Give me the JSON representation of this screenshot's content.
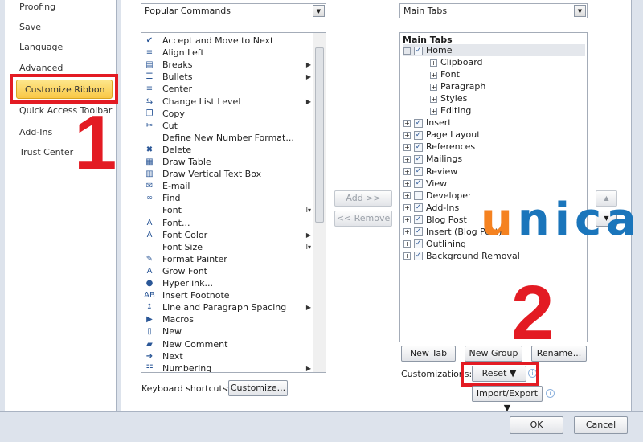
{
  "sidebar": {
    "items": [
      "Proofing",
      "Save",
      "Language",
      "Advanced",
      "Customize Ribbon",
      "Quick Access Toolbar",
      "Add-Ins",
      "Trust Center"
    ],
    "selected": "Customize Ribbon"
  },
  "annotations": {
    "step1": "1",
    "step2": "2",
    "highlight_color": "#e31b23"
  },
  "commands": {
    "dropdown": "Popular Commands",
    "items": [
      {
        "label": "Accept and Move to Next",
        "icon": "accept-icon",
        "sub": ""
      },
      {
        "label": "Align Left",
        "icon": "align-left-icon",
        "sub": ""
      },
      {
        "label": "Breaks",
        "icon": "breaks-icon",
        "sub": "▶"
      },
      {
        "label": "Bullets",
        "icon": "bullets-icon",
        "sub": "▶"
      },
      {
        "label": "Center",
        "icon": "center-icon",
        "sub": ""
      },
      {
        "label": "Change List Level",
        "icon": "list-level-icon",
        "sub": "▶"
      },
      {
        "label": "Copy",
        "icon": "copy-icon",
        "sub": ""
      },
      {
        "label": "Cut",
        "icon": "scissors-icon",
        "sub": ""
      },
      {
        "label": "Define New Number Format...",
        "icon": "",
        "sub": ""
      },
      {
        "label": "Delete",
        "icon": "delete-icon",
        "sub": ""
      },
      {
        "label": "Draw Table",
        "icon": "draw-table-icon",
        "sub": ""
      },
      {
        "label": "Draw Vertical Text Box",
        "icon": "text-box-icon",
        "sub": ""
      },
      {
        "label": "E-mail",
        "icon": "email-icon",
        "sub": ""
      },
      {
        "label": "Find",
        "icon": "binoculars-icon",
        "sub": ""
      },
      {
        "label": "Font",
        "icon": "",
        "sub": "I▾"
      },
      {
        "label": "Font...",
        "icon": "font-icon",
        "sub": ""
      },
      {
        "label": "Font Color",
        "icon": "font-color-icon",
        "sub": "▶"
      },
      {
        "label": "Font Size",
        "icon": "",
        "sub": "I▾"
      },
      {
        "label": "Format Painter",
        "icon": "brush-icon",
        "sub": ""
      },
      {
        "label": "Grow Font",
        "icon": "grow-font-icon",
        "sub": ""
      },
      {
        "label": "Hyperlink...",
        "icon": "globe-icon",
        "sub": ""
      },
      {
        "label": "Insert Footnote",
        "icon": "footnote-icon",
        "sub": ""
      },
      {
        "label": "Line and Paragraph Spacing",
        "icon": "spacing-icon",
        "sub": "▶"
      },
      {
        "label": "Macros",
        "icon": "play-icon",
        "sub": ""
      },
      {
        "label": "New",
        "icon": "new-doc-icon",
        "sub": ""
      },
      {
        "label": "New Comment",
        "icon": "comment-icon",
        "sub": ""
      },
      {
        "label": "Next",
        "icon": "next-icon",
        "sub": ""
      },
      {
        "label": "Numbering",
        "icon": "numbering-icon",
        "sub": "▶"
      }
    ]
  },
  "glyphs": {
    "accept-icon": "✔",
    "align-left-icon": "≡",
    "breaks-icon": "▤",
    "bullets-icon": "☰",
    "center-icon": "≡",
    "list-level-icon": "⇆",
    "copy-icon": "❐",
    "scissors-icon": "✂",
    "delete-icon": "✖",
    "draw-table-icon": "▦",
    "text-box-icon": "▥",
    "email-icon": "✉",
    "binoculars-icon": "∞",
    "font-icon": "A",
    "font-color-icon": "A",
    "brush-icon": "✎",
    "grow-font-icon": "A",
    "globe-icon": "●",
    "footnote-icon": "AB",
    "spacing-icon": "↕",
    "play-icon": "▶",
    "new-doc-icon": "▯",
    "comment-icon": "▰",
    "next-icon": "➔",
    "numbering-icon": "☷"
  },
  "transfer": {
    "add": "Add >>",
    "remove": "<< Remove"
  },
  "tabs": {
    "dropdown": "Main Tabs",
    "header": "Main Tabs",
    "items": [
      {
        "label": "Home",
        "level": 0,
        "expanded": true,
        "checked": true
      },
      {
        "label": "Clipboard",
        "level": 1
      },
      {
        "label": "Font",
        "level": 1
      },
      {
        "label": "Paragraph",
        "level": 1
      },
      {
        "label": "Styles",
        "level": 1
      },
      {
        "label": "Editing",
        "level": 1
      },
      {
        "label": "Insert",
        "level": 0,
        "checked": true
      },
      {
        "label": "Page Layout",
        "level": 0,
        "checked": true
      },
      {
        "label": "References",
        "level": 0,
        "checked": true
      },
      {
        "label": "Mailings",
        "level": 0,
        "checked": true
      },
      {
        "label": "Review",
        "level": 0,
        "checked": true
      },
      {
        "label": "View",
        "level": 0,
        "checked": true
      },
      {
        "label": "Developer",
        "level": 0,
        "checked": false
      },
      {
        "label": "Add-Ins",
        "level": 0,
        "checked": true
      },
      {
        "label": "Blog Post",
        "level": 0,
        "checked": true
      },
      {
        "label": "Insert (Blog Post)",
        "level": 0,
        "checked": true
      },
      {
        "label": "Outlining",
        "level": 0,
        "checked": true
      },
      {
        "label": "Background Removal",
        "level": 0,
        "checked": true
      }
    ]
  },
  "tab_buttons": {
    "new_tab": "New Tab",
    "new_group": "New Group",
    "rename": "Rename..."
  },
  "customizations": {
    "label": "Customizations:",
    "reset": "Reset ▼",
    "import_export": "Import/Export ▼"
  },
  "keyboard": {
    "label": "Keyboard shortcuts:",
    "customize": "Customize..."
  },
  "footer": {
    "ok": "OK",
    "cancel": "Cancel"
  },
  "watermark": {
    "logo": "unica",
    "colors": {
      "u": "#f58220",
      "rest": "#1a75bb"
    }
  }
}
